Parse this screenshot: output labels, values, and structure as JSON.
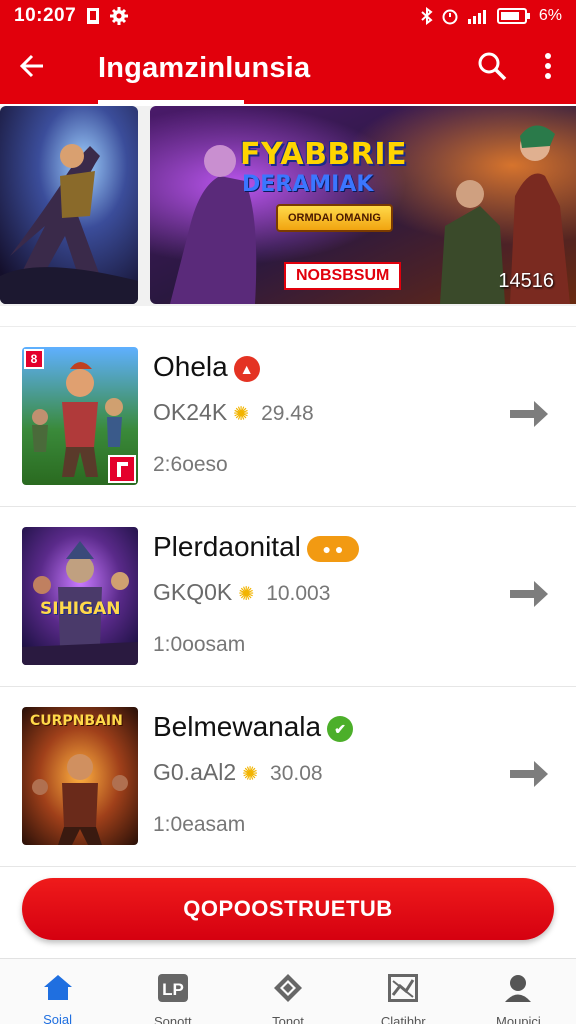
{
  "status_bar": {
    "time": "10:207",
    "battery": "6%",
    "icons": [
      "notification-icon",
      "gear-icon",
      "bluetooth-icon",
      "alarm-icon",
      "wifi-icon",
      "battery-icon"
    ]
  },
  "app_bar": {
    "title": "Ingamzinlunsia",
    "icons": [
      "back-arrow-icon",
      "search-icon",
      "more-vert-icon"
    ]
  },
  "banner": {
    "headline": "FYABBRIE",
    "subheadline": "DERAMIAK",
    "tag": "ORMDAI OMANIG",
    "label": "NOBSBSUM",
    "count": "14516"
  },
  "games": [
    {
      "title": "Ohela",
      "meta": "OK24K",
      "rating": "29.48",
      "time": "2:6oeso",
      "badge_color": "#e43323",
      "thumb_badge_color": "#e4002b"
    },
    {
      "title": "Plerdaonital",
      "meta": "GKQ0K",
      "rating": "10.003",
      "time": "1:0oosam",
      "badge_color": "#f29a12",
      "thumb_caption": "SIHIGAN"
    },
    {
      "title": "Belmewanala",
      "meta": "G0.aAl2",
      "rating": "30.08",
      "time": "1:0easam",
      "badge_color": "#4caf2a",
      "thumb_caption": "CURPNBAIN"
    }
  ],
  "cta": {
    "label": "QOPOOSTRUETUB"
  },
  "bottom_nav": {
    "items": [
      {
        "label": "Soial",
        "icon": "home-icon",
        "active": true
      },
      {
        "label": "Sonott",
        "icon": "lp-icon",
        "active": false
      },
      {
        "label": "Tonot",
        "icon": "diamond-icon",
        "active": false
      },
      {
        "label": "Clatihbr",
        "icon": "chart-icon",
        "active": false
      },
      {
        "label": "Moupici",
        "icon": "profile-icon",
        "active": false
      }
    ]
  },
  "colors": {
    "brand": "#e1000c",
    "accent": "#1f6fe0",
    "text_primary": "#111111",
    "text_secondary": "#777777"
  }
}
